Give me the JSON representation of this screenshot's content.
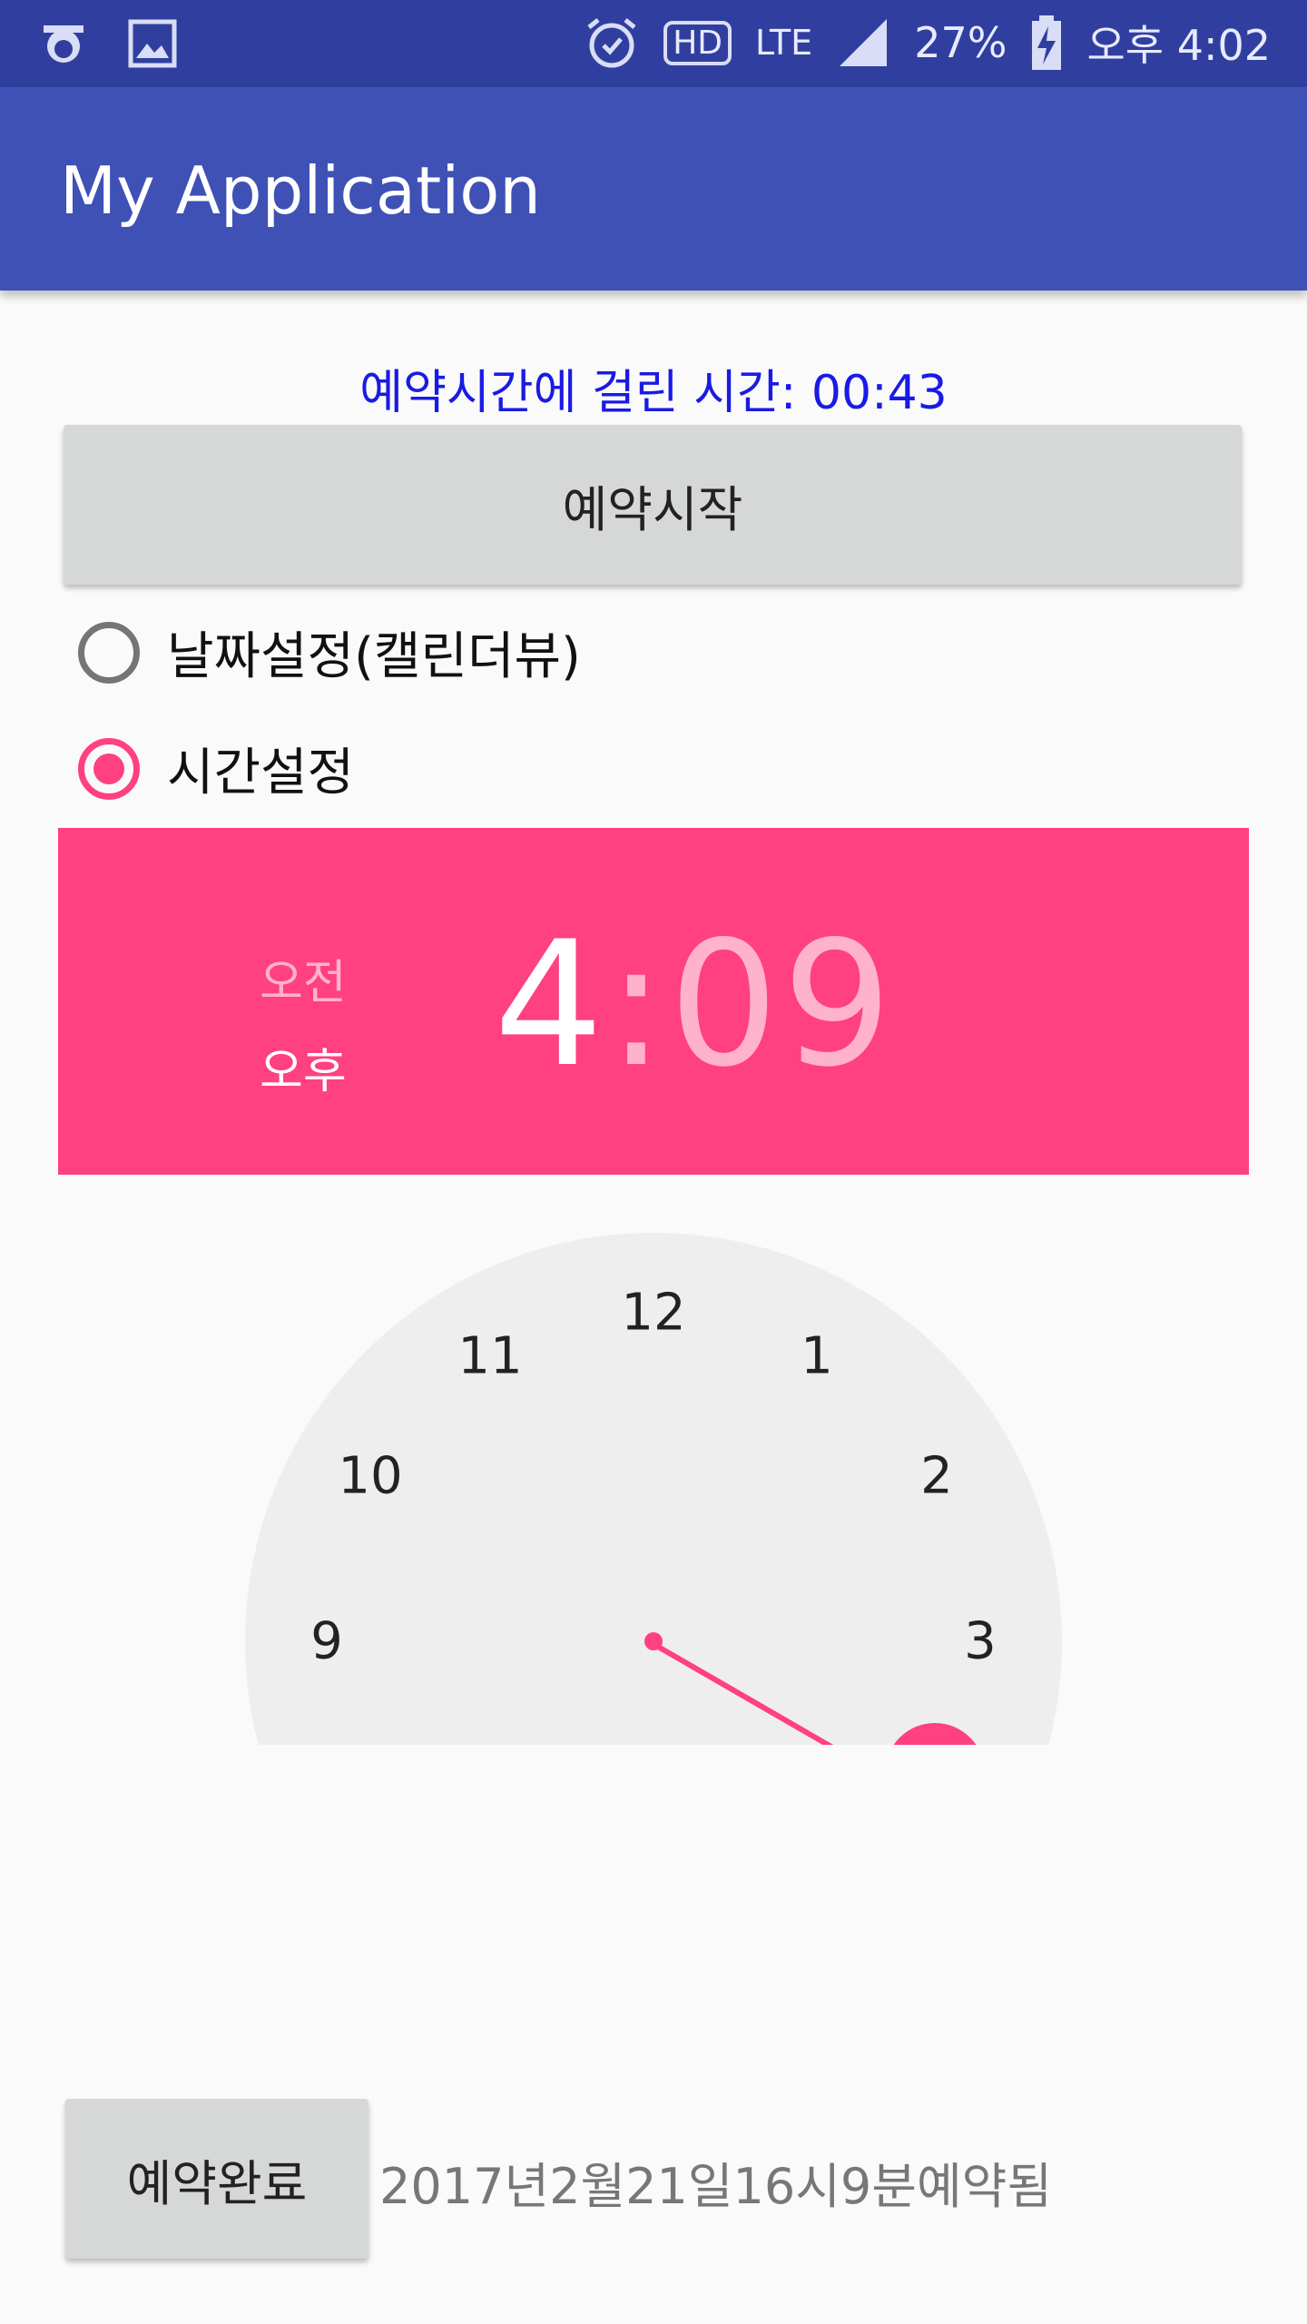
{
  "status_bar": {
    "icons_left": [
      "carrier-logo-icon",
      "gallery-notification-icon"
    ],
    "hd": "HD",
    "network": "LTE",
    "battery": "27%",
    "time": "오후 4:02"
  },
  "app_bar": {
    "title": "My Application"
  },
  "elapsed_label": "예약시간에 걸린 시간: 00:43",
  "start_button": "예약시작",
  "radio_options": [
    {
      "label": "날짜설정(캘린더뷰)",
      "checked": false
    },
    {
      "label": "시간설정",
      "checked": true
    }
  ],
  "time_picker": {
    "am": "오전",
    "pm": "오후",
    "hour": "4",
    "separator": ":",
    "minute": "09",
    "clock_numbers": [
      "12",
      "1",
      "2",
      "3",
      "9",
      "10",
      "11"
    ],
    "accent_color": "#FF4081"
  },
  "done_button": "예약완료",
  "result_text": "2017년2월21일16시9분예약됨",
  "colors": {
    "status_bar": "#303F9F",
    "app_bar": "#3F51B5",
    "accent": "#FF4081"
  }
}
